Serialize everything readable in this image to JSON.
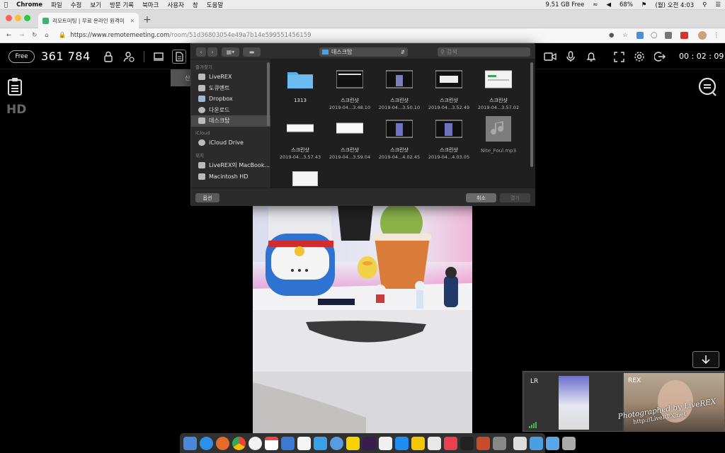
{
  "menubar": {
    "app": "Chrome",
    "items": [
      "파일",
      "수정",
      "보기",
      "방문 기록",
      "북마크",
      "사용자",
      "창",
      "도움말"
    ],
    "disk": "9.51 GB Free",
    "battery": "68%",
    "clock": "(월) 오전 4:03"
  },
  "tab": {
    "title": "리모트미팅 | 무료 온라인 원격미"
  },
  "address": {
    "url_host": "https://www.remotemeeting.com",
    "url_path": "/room/51d36803054e49a7b14e599551456159"
  },
  "toolbar": {
    "plan": "Free",
    "room_number": "361 784",
    "timer": "00 : 02 : 09",
    "left_label": "HD",
    "tooltip_partial": "신"
  },
  "dialog": {
    "location": "데스크탑",
    "search_placeholder": "검색",
    "favorites_header": "즐겨찾기",
    "favorites": [
      "LiveREX",
      "도큐멘트",
      "Dropbox",
      "다운로드",
      "데스크탑"
    ],
    "icloud_header": "iCloud",
    "icloud": [
      "iCloud Drive"
    ],
    "locations_header": "위치",
    "locations": [
      "LiveREX의 MacBook...",
      "Macintosh HD"
    ],
    "files": [
      {
        "name": "1313",
        "sub": ""
      },
      {
        "name": "스크린샷",
        "sub": "2019-04...3.48.10"
      },
      {
        "name": "스크린샷",
        "sub": "2019-04...3.50.10"
      },
      {
        "name": "스크린샷",
        "sub": "2019-04...3.52.49"
      },
      {
        "name": "스크린샷",
        "sub": "2019-04...3.57.02"
      },
      {
        "name": "스크린샷",
        "sub": "2019-04...3.57.43"
      },
      {
        "name": "스크린샷",
        "sub": "2019-04...3.59.04"
      },
      {
        "name": "스크린샷",
        "sub": "2019-04...4.02.45"
      },
      {
        "name": "스크린샷",
        "sub": "2019-04...4.03.05"
      },
      {
        "name": "Nite_Foul.mp3",
        "sub": ""
      }
    ],
    "options_button": "옵션",
    "cancel_button": "취소",
    "open_button": "열기"
  },
  "participants": {
    "p1": "LR",
    "p2": "REX"
  },
  "watermark": {
    "line1": "Photographed by LiveREX",
    "line2": "http://LiveREX.net"
  }
}
